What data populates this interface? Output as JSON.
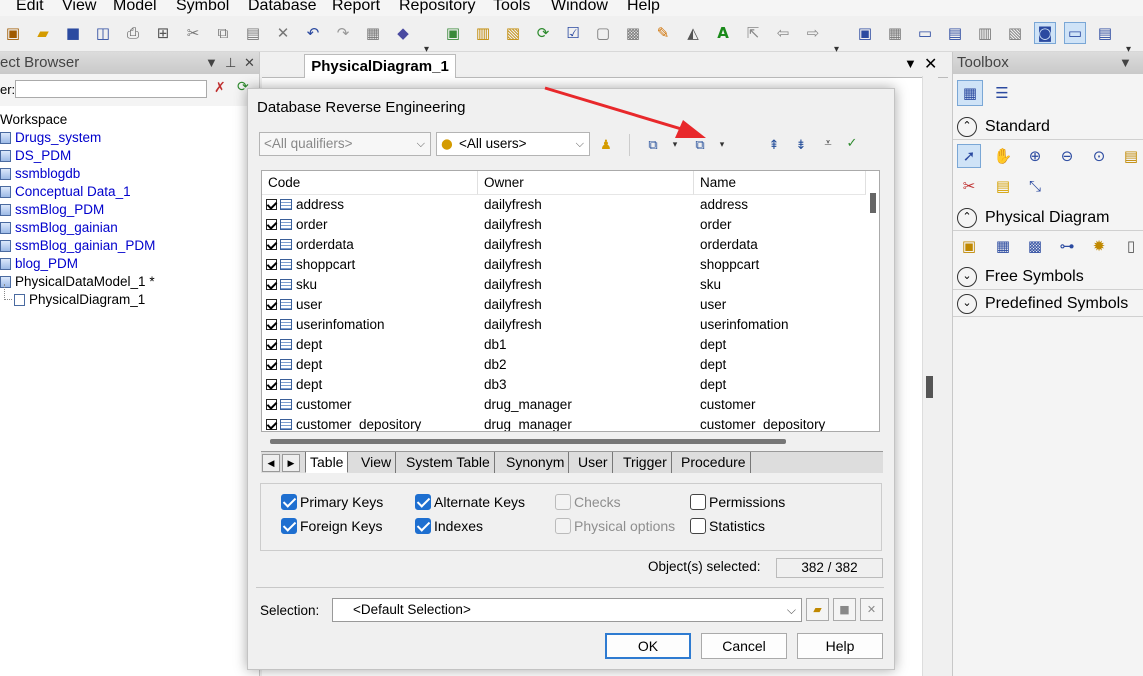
{
  "menu": [
    "Edit",
    "View",
    "Model",
    "Symbol",
    "Database",
    "Report",
    "Repository",
    "Tools",
    "Window",
    "Help"
  ],
  "browser": {
    "title": "ect Browser",
    "filter_label": "er:",
    "filter_value": "",
    "items": [
      "Workspace",
      "Drugs_system",
      "DS_PDM",
      "ssmblogdb",
      "Conceptual Data_1",
      "ssmBlog_PDM",
      "ssmBlog_gainian",
      "ssmBlog_gainian_PDM",
      "blog_PDM",
      "PhysicalDataModel_1 *",
      "PhysicalDiagram_1"
    ]
  },
  "diagram": {
    "tab": "PhysicalDiagram_1"
  },
  "toolbox": {
    "title": "Toolbox",
    "sections": [
      "Standard",
      "Physical Diagram",
      "Free Symbols",
      "Predefined Symbols"
    ]
  },
  "dialog": {
    "title": "Database Reverse Engineering",
    "qualifier": "<All qualifiers>",
    "users": "<All users>",
    "columns": [
      "Code",
      "Owner",
      "Name"
    ],
    "rows": [
      [
        "address",
        "dailyfresh",
        "address"
      ],
      [
        "order",
        "dailyfresh",
        "order"
      ],
      [
        "orderdata",
        "dailyfresh",
        "orderdata"
      ],
      [
        "shoppcart",
        "dailyfresh",
        "shoppcart"
      ],
      [
        "sku",
        "dailyfresh",
        "sku"
      ],
      [
        "user",
        "dailyfresh",
        "user"
      ],
      [
        "userinfomation",
        "dailyfresh",
        "userinfomation"
      ],
      [
        "dept",
        "db1",
        "dept"
      ],
      [
        "dept",
        "db2",
        "dept"
      ],
      [
        "dept",
        "db3",
        "dept"
      ],
      [
        "customer",
        "drug_manager",
        "customer"
      ],
      [
        "customer_depository",
        "drug_manager",
        "customer_depository"
      ]
    ],
    "tabs": [
      "Table",
      "View",
      "System Table",
      "Synonym",
      "User",
      "Trigger",
      "Procedure"
    ],
    "options": {
      "primary_keys": "Primary Keys",
      "foreign_keys": "Foreign Keys",
      "alternate_keys": "Alternate Keys",
      "indexes": "Indexes",
      "checks": "Checks",
      "physical_options": "Physical options",
      "permissions": "Permissions",
      "statistics": "Statistics"
    },
    "selected_label": "Object(s) selected:",
    "selected_count": "382 / 382",
    "selection_label": "Selection:",
    "selection_value": "<Default Selection>",
    "ok": "OK",
    "cancel": "Cancel",
    "help": "Help"
  },
  "colors": {
    "accent": "#1e6fd0",
    "arrow": "#e8282b",
    "link": "#0000cc"
  }
}
